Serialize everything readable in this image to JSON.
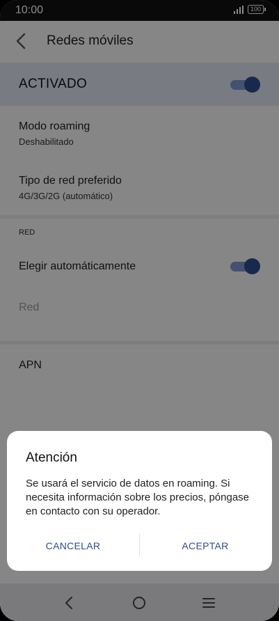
{
  "status_bar": {
    "time": "10:00",
    "battery": "100"
  },
  "top_bar": {
    "title": "Redes móviles",
    "back_icon": "chevron-left-icon"
  },
  "master": {
    "label": "ACTIVADO",
    "enabled": true
  },
  "settings": {
    "roaming": {
      "title": "Modo roaming",
      "subtitle": "Deshabilitado"
    },
    "network_type": {
      "title": "Tipo de red preferido",
      "subtitle": "4G/3G/2G (automático)"
    }
  },
  "section_red": {
    "header": "RED",
    "auto_select": {
      "title": "Elegir automáticamente",
      "enabled": true
    },
    "network": {
      "title": "Red"
    }
  },
  "apn": {
    "title": "APN"
  },
  "dialog": {
    "title": "Atención",
    "body": "Se usará el servicio de datos en roaming. Si necesita información sobre los precios, póngase en contacto con su operador.",
    "cancel_label": "CANCELAR",
    "accept_label": "ACEPTAR"
  },
  "nav": {
    "back_icon": "triangle-back-icon",
    "home_icon": "circle-home-icon",
    "menu_icon": "menu-lines-icon"
  },
  "colors": {
    "accent": "#2f4b8e",
    "accent_track": "#7f97cf",
    "master_bg": "#dfe3f1"
  }
}
